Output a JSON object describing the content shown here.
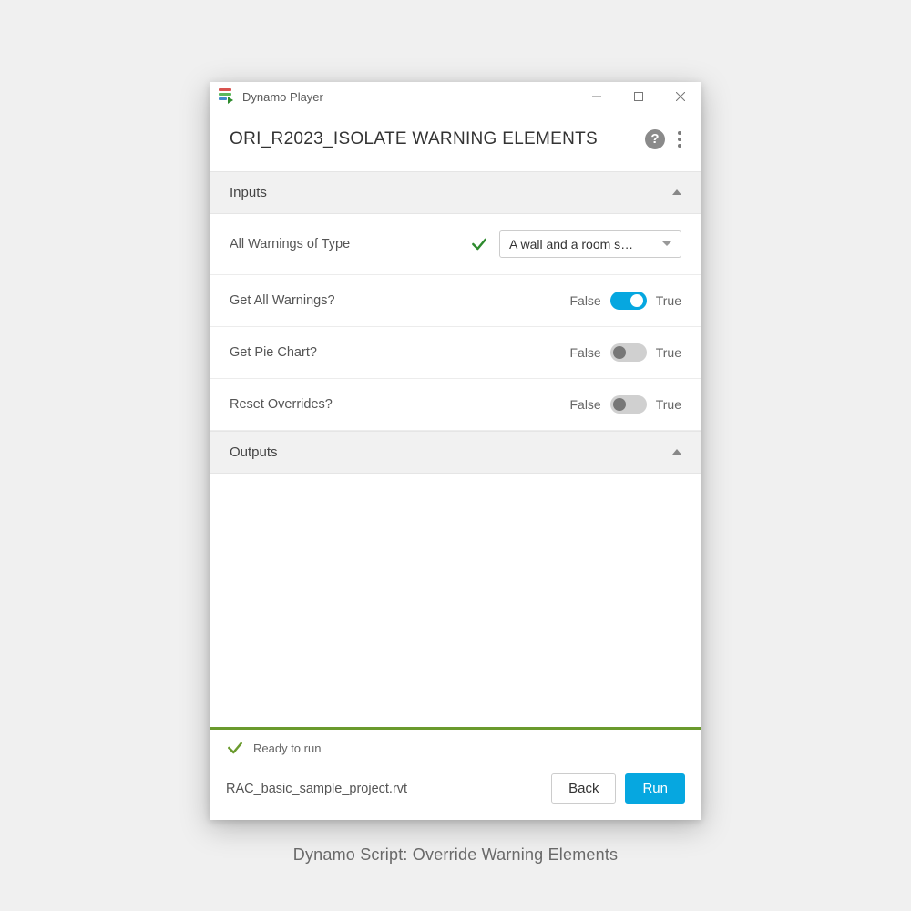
{
  "window": {
    "app_title": "Dynamo Player"
  },
  "script": {
    "title": "ORI_R2023_ISOLATE WARNING ELEMENTS"
  },
  "sections": {
    "inputs_label": "Inputs",
    "outputs_label": "Outputs"
  },
  "inputs": {
    "warnings_of_type": {
      "label": "All Warnings of Type",
      "selected": "A wall and a room s…"
    },
    "get_all_warnings": {
      "label": "Get All Warnings?",
      "false_label": "False",
      "true_label": "True",
      "value": true
    },
    "get_pie_chart": {
      "label": "Get Pie Chart?",
      "false_label": "False",
      "true_label": "True",
      "value": false
    },
    "reset_overrides": {
      "label": "Reset Overrides?",
      "false_label": "False",
      "true_label": "True",
      "value": false
    }
  },
  "footer": {
    "status": "Ready to run",
    "filename": "RAC_basic_sample_project.rvt",
    "back": "Back",
    "run": "Run"
  },
  "caption": "Dynamo Script: Override Warning Elements"
}
